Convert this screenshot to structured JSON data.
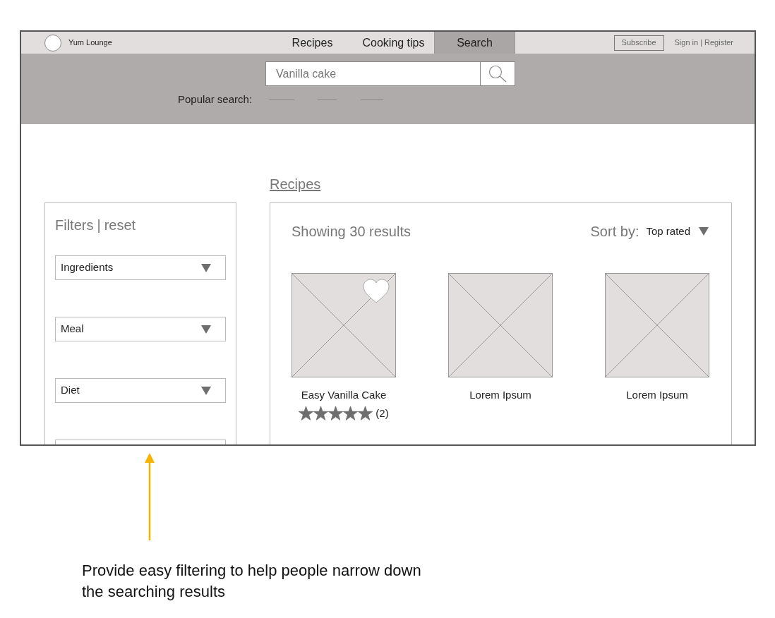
{
  "nav": {
    "brand": "Yum Lounge",
    "tabs": [
      {
        "label": "Recipes",
        "selected": false
      },
      {
        "label": "Cooking tips",
        "selected": false
      },
      {
        "label": "Search",
        "selected": true
      }
    ],
    "subscribe": "Subscribe",
    "sign_in": "Sign in",
    "separator": "|",
    "register": "Register"
  },
  "search": {
    "value": "Vanilla cake",
    "popular_label": "Popular search:"
  },
  "section_link": "Recipes",
  "filters": {
    "title": "Filters",
    "separator": "|",
    "reset": "reset",
    "items": [
      {
        "label": "Ingredients"
      },
      {
        "label": "Meal"
      },
      {
        "label": "Diet"
      }
    ],
    "partial_filter": true
  },
  "results": {
    "count_text": "Showing 30 results",
    "sort_label": "Sort by:",
    "sort_value": "Top rated",
    "cards": [
      {
        "title": "Easy Vanilla Cake",
        "favorite": true,
        "stars": 5,
        "reviews": "(2)"
      },
      {
        "title": "Lorem Ipsum",
        "favorite": false
      },
      {
        "title": "Lorem Ipsum",
        "favorite": false
      }
    ]
  },
  "annotation": "Provide easy filtering to help people narrow down the searching results"
}
